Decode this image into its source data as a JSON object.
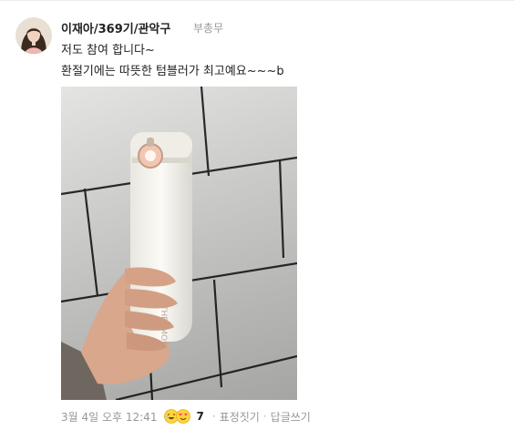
{
  "comment": {
    "author": "이재아/369기/관악구",
    "role": "부총무",
    "lines": [
      "저도 참여 합니다~",
      "환절기에는 따뜻한 텀블러가 최고예요~~~b"
    ],
    "photo_text": "THERMOS",
    "date": "3월 4일 오후 12:41",
    "reaction_count": "7",
    "reaction_icons": [
      "laughing-face-icon",
      "heart-eyes-face-icon"
    ],
    "separator": "·",
    "actions": {
      "react_label": "표정짓기",
      "reply_label": "답글쓰기"
    }
  }
}
